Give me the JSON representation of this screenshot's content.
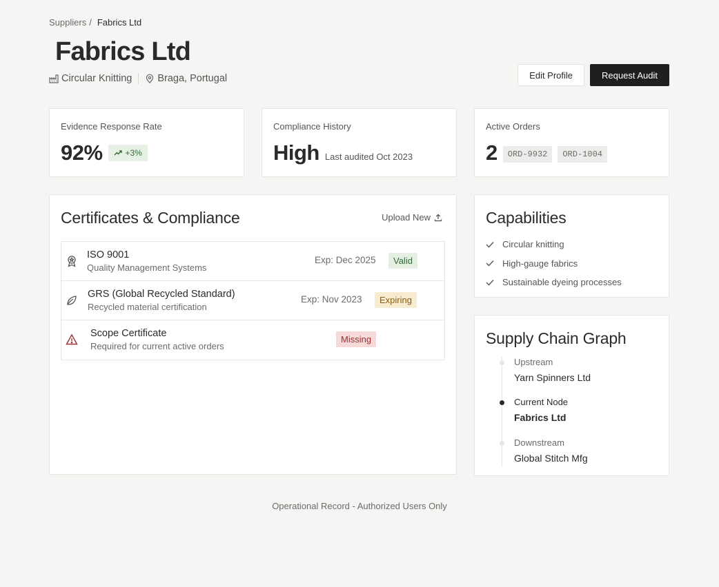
{
  "breadcrumb": {
    "parent": "Suppliers",
    "separator": "/",
    "current": "Fabrics Ltd"
  },
  "supplier": {
    "name": "Fabrics Ltd",
    "category": "Circular Knitting",
    "location": "Braga, Portugal"
  },
  "actions": {
    "edit_label": "Edit Profile",
    "audit_label": "Request Audit"
  },
  "stats": {
    "evidence": {
      "label": "Evidence Response Rate",
      "value": "92%",
      "trend": "+3%"
    },
    "compliance": {
      "label": "Compliance History",
      "value": "High",
      "note": "Last audited Oct 2023"
    },
    "orders": {
      "label": "Active Orders",
      "value": "2",
      "tags": [
        "ORD-9932",
        "ORD-1004"
      ]
    }
  },
  "certificates": {
    "title": "Certificates & Compliance",
    "upload_label": "Upload New",
    "items": [
      {
        "name": "ISO 9001",
        "desc": "Quality Management Systems",
        "exp": "Exp: Dec 2025",
        "status": "Valid",
        "icon": "award-icon"
      },
      {
        "name": "GRS (Global Recycled Standard)",
        "desc": "Recycled material certification",
        "exp": "Exp: Nov 2023",
        "status": "Expiring",
        "icon": "leaf-icon"
      },
      {
        "name": "Scope Certificate",
        "desc": "Required for current active orders",
        "exp": "",
        "status": "Missing",
        "icon": "warning-icon"
      }
    ]
  },
  "capabilities": {
    "title": "Capabilities",
    "items": [
      "Circular knitting",
      "High-gauge fabrics",
      "Sustainable dyeing processes"
    ]
  },
  "supply_chain": {
    "title": "Supply Chain Graph",
    "nodes": [
      {
        "label": "Upstream",
        "value": "Yarn Spinners Ltd"
      },
      {
        "label": "Current Node",
        "value": "Fabrics Ltd"
      },
      {
        "label": "Downstream",
        "value": "Global Stitch Mfg"
      }
    ]
  },
  "footer": "Operational Record - Authorized Users Only",
  "colors": {
    "primary": "#1f1f1d",
    "valid": "#2f6b34",
    "expiring": "#8a5a12",
    "missing": "#9b2f2f"
  }
}
